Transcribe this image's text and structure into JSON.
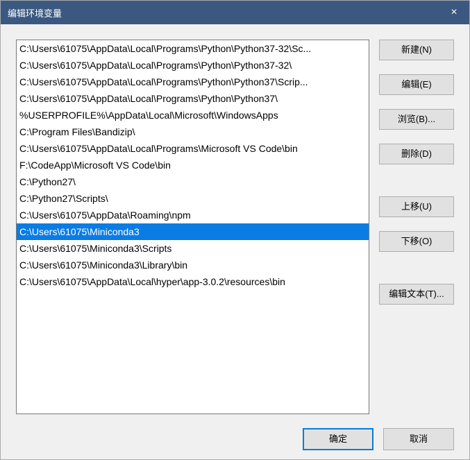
{
  "window": {
    "title": "编辑环境变量",
    "close_icon": "×"
  },
  "list": {
    "items": [
      "C:\\Users\\61075\\AppData\\Local\\Programs\\Python\\Python37-32\\Sc...",
      "C:\\Users\\61075\\AppData\\Local\\Programs\\Python\\Python37-32\\",
      "C:\\Users\\61075\\AppData\\Local\\Programs\\Python\\Python37\\Scrip...",
      "C:\\Users\\61075\\AppData\\Local\\Programs\\Python\\Python37\\",
      "%USERPROFILE%\\AppData\\Local\\Microsoft\\WindowsApps",
      "C:\\Program Files\\Bandizip\\",
      "C:\\Users\\61075\\AppData\\Local\\Programs\\Microsoft VS Code\\bin",
      "F:\\CodeApp\\Microsoft VS Code\\bin",
      "C:\\Python27\\",
      "C:\\Python27\\Scripts\\",
      "C:\\Users\\61075\\AppData\\Roaming\\npm",
      "C:\\Users\\61075\\Miniconda3",
      "C:\\Users\\61075\\Miniconda3\\Scripts",
      "C:\\Users\\61075\\Miniconda3\\Library\\bin",
      "C:\\Users\\61075\\AppData\\Local\\hyper\\app-3.0.2\\resources\\bin"
    ],
    "selected_index": 11
  },
  "buttons": {
    "new": "新建(N)",
    "edit": "编辑(E)",
    "browse": "浏览(B)...",
    "delete": "删除(D)",
    "moveup": "上移(U)",
    "movedown": "下移(O)",
    "edittext": "编辑文本(T)...",
    "ok": "确定",
    "cancel": "取消"
  }
}
